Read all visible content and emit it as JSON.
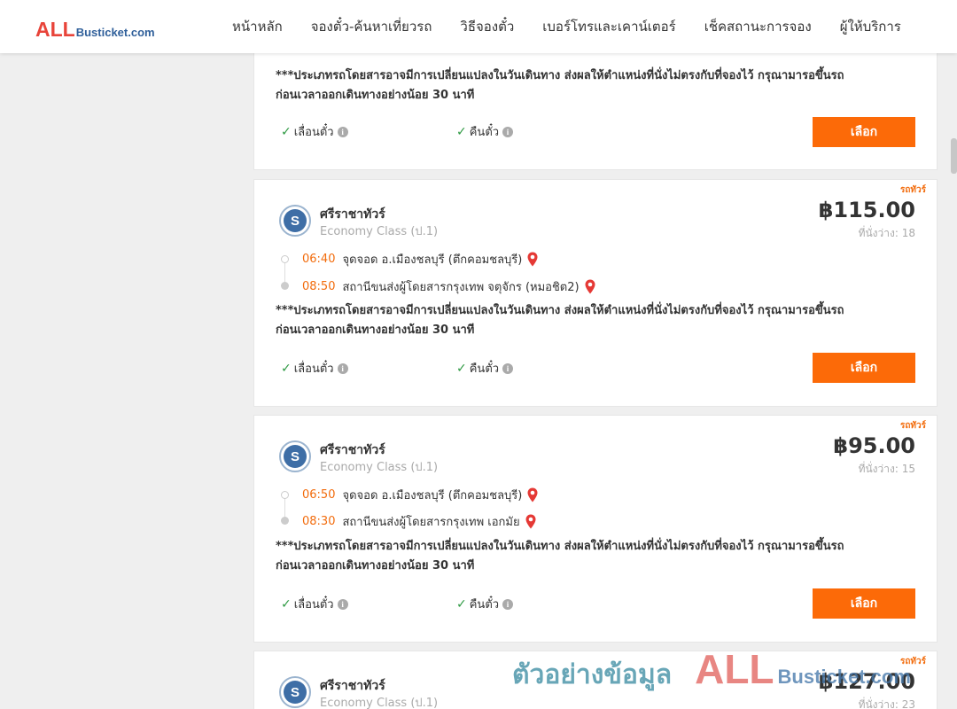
{
  "header": {
    "logo_all": "ALL",
    "logo_rest": "Busticket.com",
    "nav": [
      "หน้าหลัก",
      "จองตั๋ว-ค้นหาเที่ยวรถ",
      "วิธีจองตั๋ว",
      "เบอร์โทรและเคาน์เตอร์",
      "เช็คสถานะการจอง",
      "ผู้ให้บริการ"
    ]
  },
  "common": {
    "notice_line1": "***ประเภทรถโดยสารอาจมีการเปลี่ยนแปลงในวันเดินทาง ส่งผลให้ตำแหน่งที่นั่งไม่ตรงกับที่จองไว้ กรุณามารอขึ้นรถ",
    "notice_line2": "ก่อนเวลาออกเดินทางอย่างน้อย 30 นาที",
    "feature_reschedule": "เลื่อนตั๋ว",
    "feature_refund": "คืนตั๋ว",
    "select_label": "เลือก",
    "type_tag": "รถทัวร์",
    "info_icon": "i",
    "check_icon": "✓"
  },
  "trips": [
    {
      "operator": "ศรีราชาทัวร์",
      "class": "Economy Class (ป.1)",
      "price": "฿115.00",
      "seats": "ที่นั่งว่าง: 18",
      "depart_time": "06:40",
      "depart_place": "จุดจอด อ.เมืองชลบุรี (ตึกคอมชลบุรี)",
      "arrive_time": "08:50",
      "arrive_place": "สถานีขนส่งผู้โดยสารกรุงเทพ จตุจักร (หมอชิต2)"
    },
    {
      "operator": "ศรีราชาทัวร์",
      "class": "Economy Class (ป.1)",
      "price": "฿95.00",
      "seats": "ที่นั่งว่าง: 15",
      "depart_time": "06:50",
      "depart_place": "จุดจอด อ.เมืองชลบุรี (ตึกคอมชลบุรี)",
      "arrive_time": "08:30",
      "arrive_place": "สถานีขนส่งผู้โดยสารกรุงเทพ เอกมัย"
    },
    {
      "operator": "ศรีราชาทัวร์",
      "class": "Economy Class (ป.1)",
      "price": "฿127.00",
      "seats": "ที่นั่งว่าง: 23"
    }
  ],
  "watermark": {
    "text": "ตัวอย่างข้อมูล",
    "all": "ALL",
    "rest": "Busticket.com"
  },
  "colors": {
    "accent": "#fc6a08",
    "time": "#f26c0d",
    "check": "#2e9a43",
    "pin": "#e53935"
  }
}
